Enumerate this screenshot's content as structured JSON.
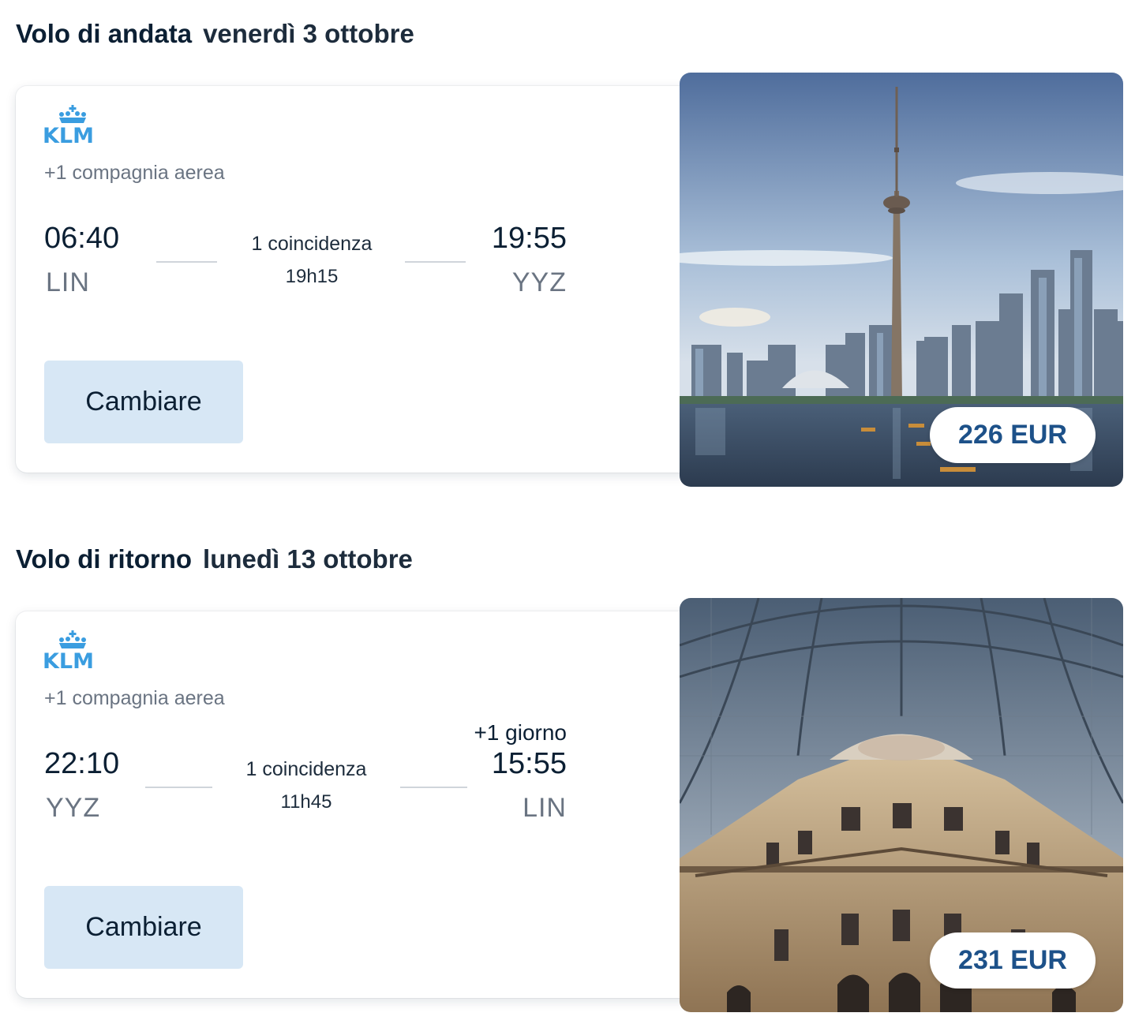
{
  "outbound": {
    "heading_title": "Volo di andata",
    "heading_date": "venerdì 3 ottobre",
    "airline_logo": "KLM",
    "airline_extra": "+1 compagnia aerea",
    "departure_time": "06:40",
    "departure_airport": "LIN",
    "stops": "1 coincidenza",
    "duration": "19h15",
    "arrival_time": "19:55",
    "arrival_airport": "YYZ",
    "change_label": "Cambiare",
    "price": "226 EUR",
    "photo": "toronto-skyline-image"
  },
  "return": {
    "heading_title": "Volo di ritorno",
    "heading_date": "lunedì 13 ottobre",
    "airline_logo": "KLM",
    "airline_extra": "+1 compagnia aerea",
    "departure_time": "22:10",
    "departure_airport": "YYZ",
    "stops": "1 coincidenza",
    "duration": "11h45",
    "arrival_next_day": "+1 giorno",
    "arrival_time": "15:55",
    "arrival_airport": "LIN",
    "change_label": "Cambiare",
    "price": "231 EUR",
    "photo": "milan-galleria-image"
  },
  "colors": {
    "klm_blue": "#3a9de0",
    "button_bg": "#d7e7f5",
    "price_text": "#1d5189",
    "text_dark": "#0b1f33",
    "text_muted": "#6a7482"
  }
}
